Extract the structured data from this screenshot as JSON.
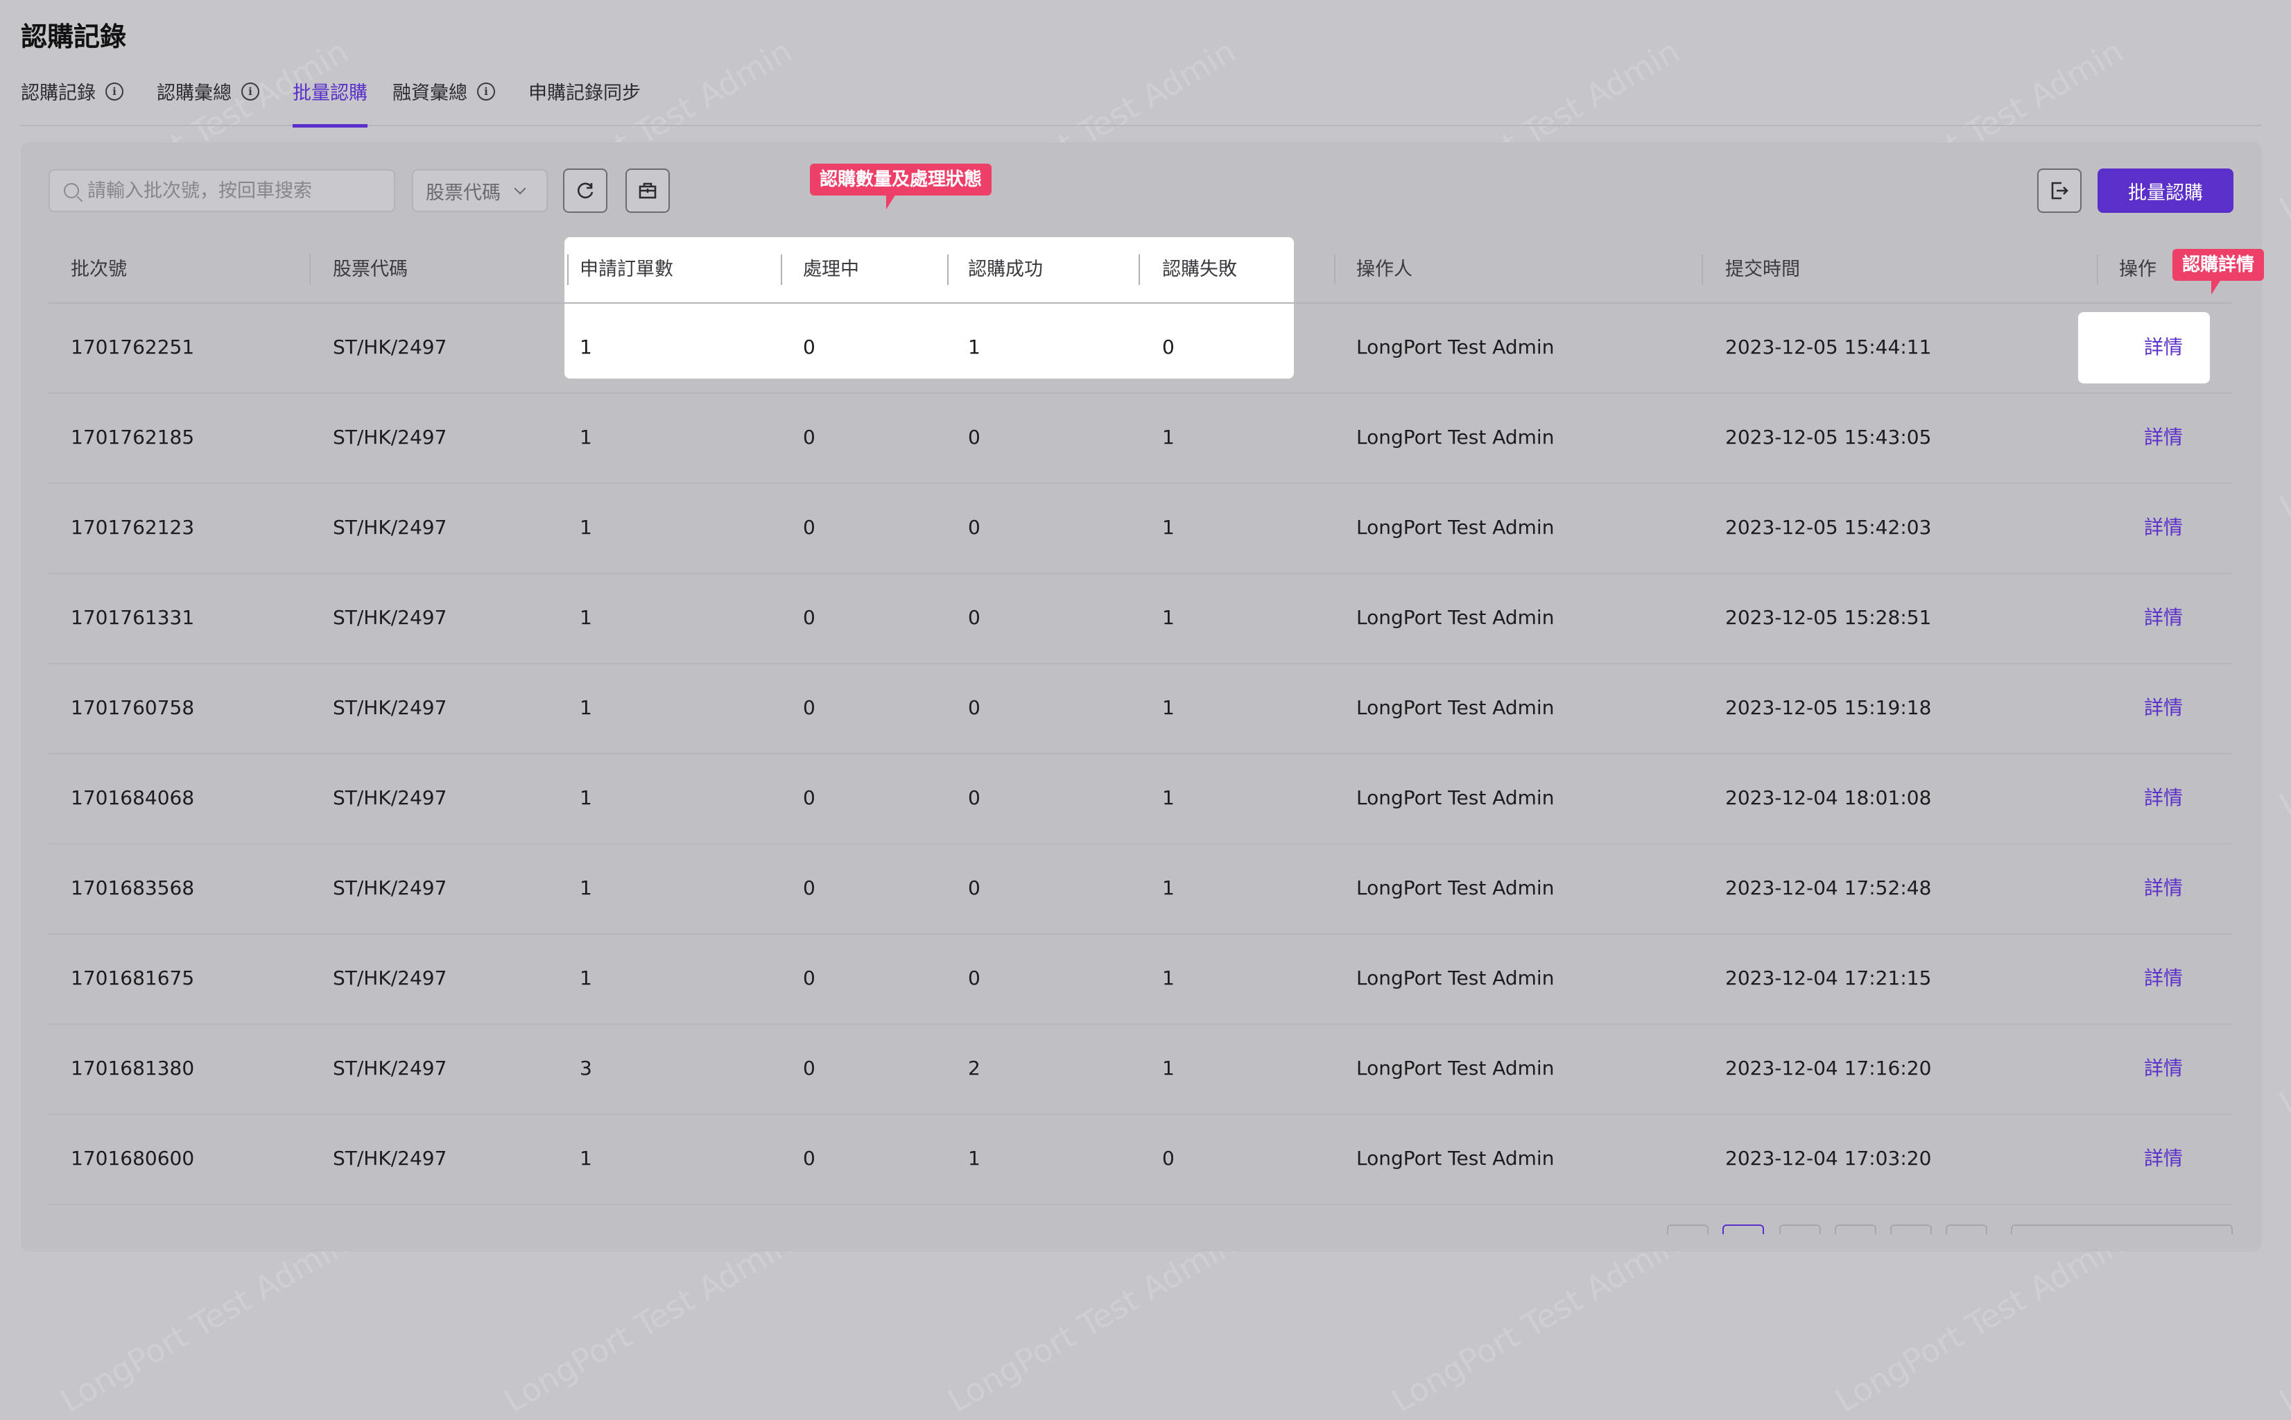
{
  "page_title": "認購記錄",
  "tabs": [
    {
      "label": "認購記錄",
      "active": false,
      "has_info": true
    },
    {
      "label": "認購彙總",
      "active": false,
      "has_info": true
    },
    {
      "label": "批量認購",
      "active": true,
      "has_info": false
    },
    {
      "label": "融資彙總",
      "active": false,
      "has_info": true
    },
    {
      "label": "申購記錄同步",
      "active": false,
      "has_info": false
    }
  ],
  "info_glyph": "i",
  "toolbar": {
    "search_placeholder": "請輸入批次號，按回車搜索",
    "stock_select_label": "股票代碼",
    "refresh_icon": "refresh-icon",
    "toolbox_icon": "toolbox-icon",
    "export_icon": "export-icon",
    "batch_button_label": "批量認購"
  },
  "table": {
    "columns": [
      "批次號",
      "股票代碼",
      "申請訂單數",
      "處理中",
      "認購成功",
      "認購失敗",
      "操作人",
      "提交時間",
      "操作"
    ],
    "rows": [
      {
        "batch": "1701762251",
        "stock": "ST/HK/2497",
        "orders": "1",
        "processing": "0",
        "success": "1",
        "failed": "0",
        "operator": "LongPort Test Admin",
        "time": "2023-12-05 15:44:11",
        "action": "詳情"
      },
      {
        "batch": "1701762185",
        "stock": "ST/HK/2497",
        "orders": "1",
        "processing": "0",
        "success": "0",
        "failed": "1",
        "operator": "LongPort Test Admin",
        "time": "2023-12-05 15:43:05",
        "action": "詳情"
      },
      {
        "batch": "1701762123",
        "stock": "ST/HK/2497",
        "orders": "1",
        "processing": "0",
        "success": "0",
        "failed": "1",
        "operator": "LongPort Test Admin",
        "time": "2023-12-05 15:42:03",
        "action": "詳情"
      },
      {
        "batch": "1701761331",
        "stock": "ST/HK/2497",
        "orders": "1",
        "processing": "0",
        "success": "0",
        "failed": "1",
        "operator": "LongPort Test Admin",
        "time": "2023-12-05 15:28:51",
        "action": "詳情"
      },
      {
        "batch": "1701760758",
        "stock": "ST/HK/2497",
        "orders": "1",
        "processing": "0",
        "success": "0",
        "failed": "1",
        "operator": "LongPort Test Admin",
        "time": "2023-12-05 15:19:18",
        "action": "詳情"
      },
      {
        "batch": "1701684068",
        "stock": "ST/HK/2497",
        "orders": "1",
        "processing": "0",
        "success": "0",
        "failed": "1",
        "operator": "LongPort Test Admin",
        "time": "2023-12-04 18:01:08",
        "action": "詳情"
      },
      {
        "batch": "1701683568",
        "stock": "ST/HK/2497",
        "orders": "1",
        "processing": "0",
        "success": "0",
        "failed": "1",
        "operator": "LongPort Test Admin",
        "time": "2023-12-04 17:52:48",
        "action": "詳情"
      },
      {
        "batch": "1701681675",
        "stock": "ST/HK/2497",
        "orders": "1",
        "processing": "0",
        "success": "0",
        "failed": "1",
        "operator": "LongPort Test Admin",
        "time": "2023-12-04 17:21:15",
        "action": "詳情"
      },
      {
        "batch": "1701681380",
        "stock": "ST/HK/2497",
        "orders": "3",
        "processing": "0",
        "success": "2",
        "failed": "1",
        "operator": "LongPort Test Admin",
        "time": "2023-12-04 17:16:20",
        "action": "詳情"
      },
      {
        "batch": "1701680600",
        "stock": "ST/HK/2497",
        "orders": "1",
        "processing": "0",
        "success": "1",
        "failed": "0",
        "operator": "LongPort Test Admin",
        "time": "2023-12-04 17:03:20",
        "action": "詳情"
      }
    ]
  },
  "annotations": {
    "quantity_status": "認購數量及處理狀態",
    "detail": "認購詳情"
  },
  "watermark_text": "LongPort Test Admin",
  "colors": {
    "accent": "#5b2fc9",
    "tooltip": "#ee3f68",
    "overlay_bg": "#c5c5ca"
  }
}
